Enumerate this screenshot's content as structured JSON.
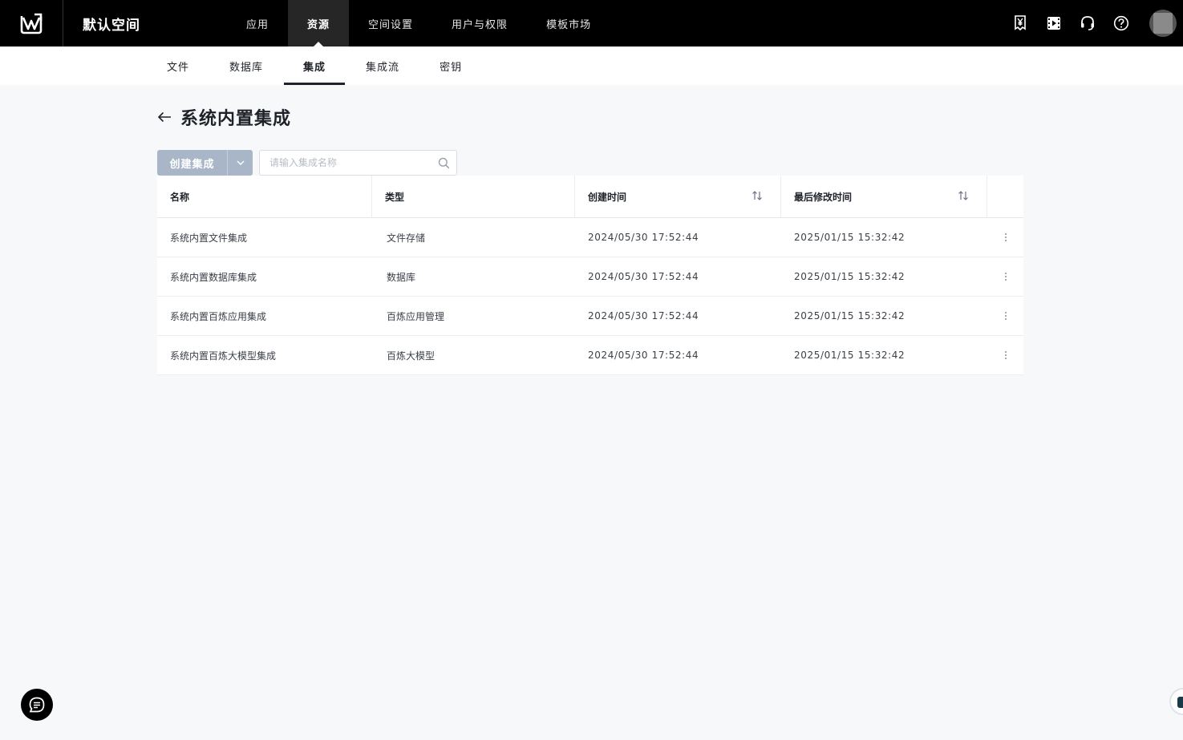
{
  "header": {
    "space_title": "默认空间",
    "nav": [
      {
        "label": "应用",
        "active": false
      },
      {
        "label": "资源",
        "active": true
      },
      {
        "label": "空间设置",
        "active": false
      },
      {
        "label": "用户与权限",
        "active": false
      },
      {
        "label": "模板市场",
        "active": false
      }
    ],
    "icons": [
      "billing-icon",
      "video-icon",
      "headset-icon",
      "help-icon"
    ]
  },
  "subnav": [
    {
      "label": "文件",
      "active": false
    },
    {
      "label": "数据库",
      "active": false
    },
    {
      "label": "集成",
      "active": true
    },
    {
      "label": "集成流",
      "active": false
    },
    {
      "label": "密钥",
      "active": false
    }
  ],
  "page": {
    "title": "系统内置集成"
  },
  "toolbar": {
    "create_label": "创建集成",
    "search_placeholder": "请输入集成名称"
  },
  "table": {
    "columns": [
      "名称",
      "类型",
      "创建时间",
      "最后修改时间"
    ],
    "rows": [
      {
        "name": "系统内置文件集成",
        "type": "文件存储",
        "created": "2024/05/30 17:52:44",
        "modified": "2025/01/15 15:32:42"
      },
      {
        "name": "系统内置数据库集成",
        "type": "数据库",
        "created": "2024/05/30 17:52:44",
        "modified": "2025/01/15 15:32:42"
      },
      {
        "name": "系统内置百炼应用集成",
        "type": "百炼应用管理",
        "created": "2024/05/30 17:52:44",
        "modified": "2025/01/15 15:32:42"
      },
      {
        "name": "系统内置百炼大模型集成",
        "type": "百炼大模型",
        "created": "2024/05/30 17:52:44",
        "modified": "2025/01/15 15:32:42"
      }
    ]
  },
  "colors": {
    "topbar_bg": "#000000",
    "primary_disabled": "#a8b6c8",
    "page_bg": "#f7f8fa"
  }
}
